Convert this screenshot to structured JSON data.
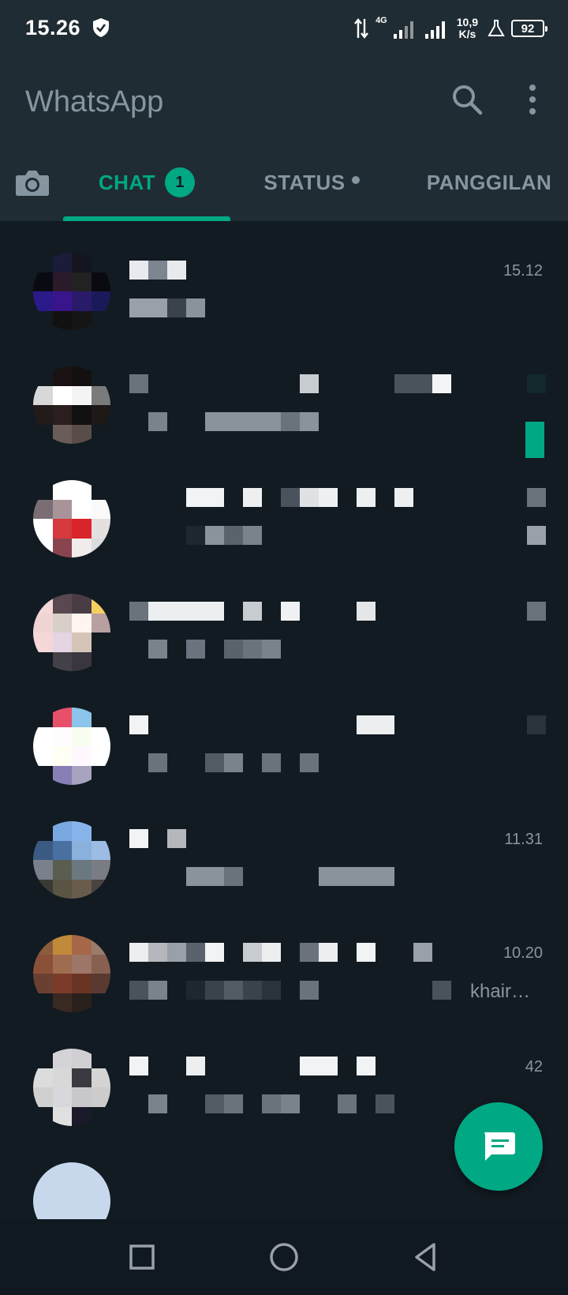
{
  "statusbar": {
    "time": "15.26",
    "network": "4G",
    "speed_value": "10,9",
    "speed_unit": "K/s",
    "battery": "92"
  },
  "app": {
    "title": "WhatsApp"
  },
  "tabs": {
    "chat_label": "CHAT",
    "chat_badge": "1",
    "status_label": "STATUS",
    "calls_label": "PANGGILAN"
  },
  "chats": [
    {
      "time": "15.12",
      "preview_tail": ""
    },
    {
      "time": "",
      "preview_tail": ""
    },
    {
      "time": "",
      "preview_tail": ""
    },
    {
      "time": "",
      "preview_tail": ""
    },
    {
      "time": "",
      "preview_tail": ""
    },
    {
      "time": "11.31",
      "preview_tail": ""
    },
    {
      "time": "10.20",
      "preview_tail": "khair…"
    },
    {
      "time": "42",
      "preview_tail": ""
    }
  ],
  "colors": {
    "accent": "#00a884",
    "background": "#121b22",
    "header": "#202c33",
    "muted": "#8696a0"
  }
}
